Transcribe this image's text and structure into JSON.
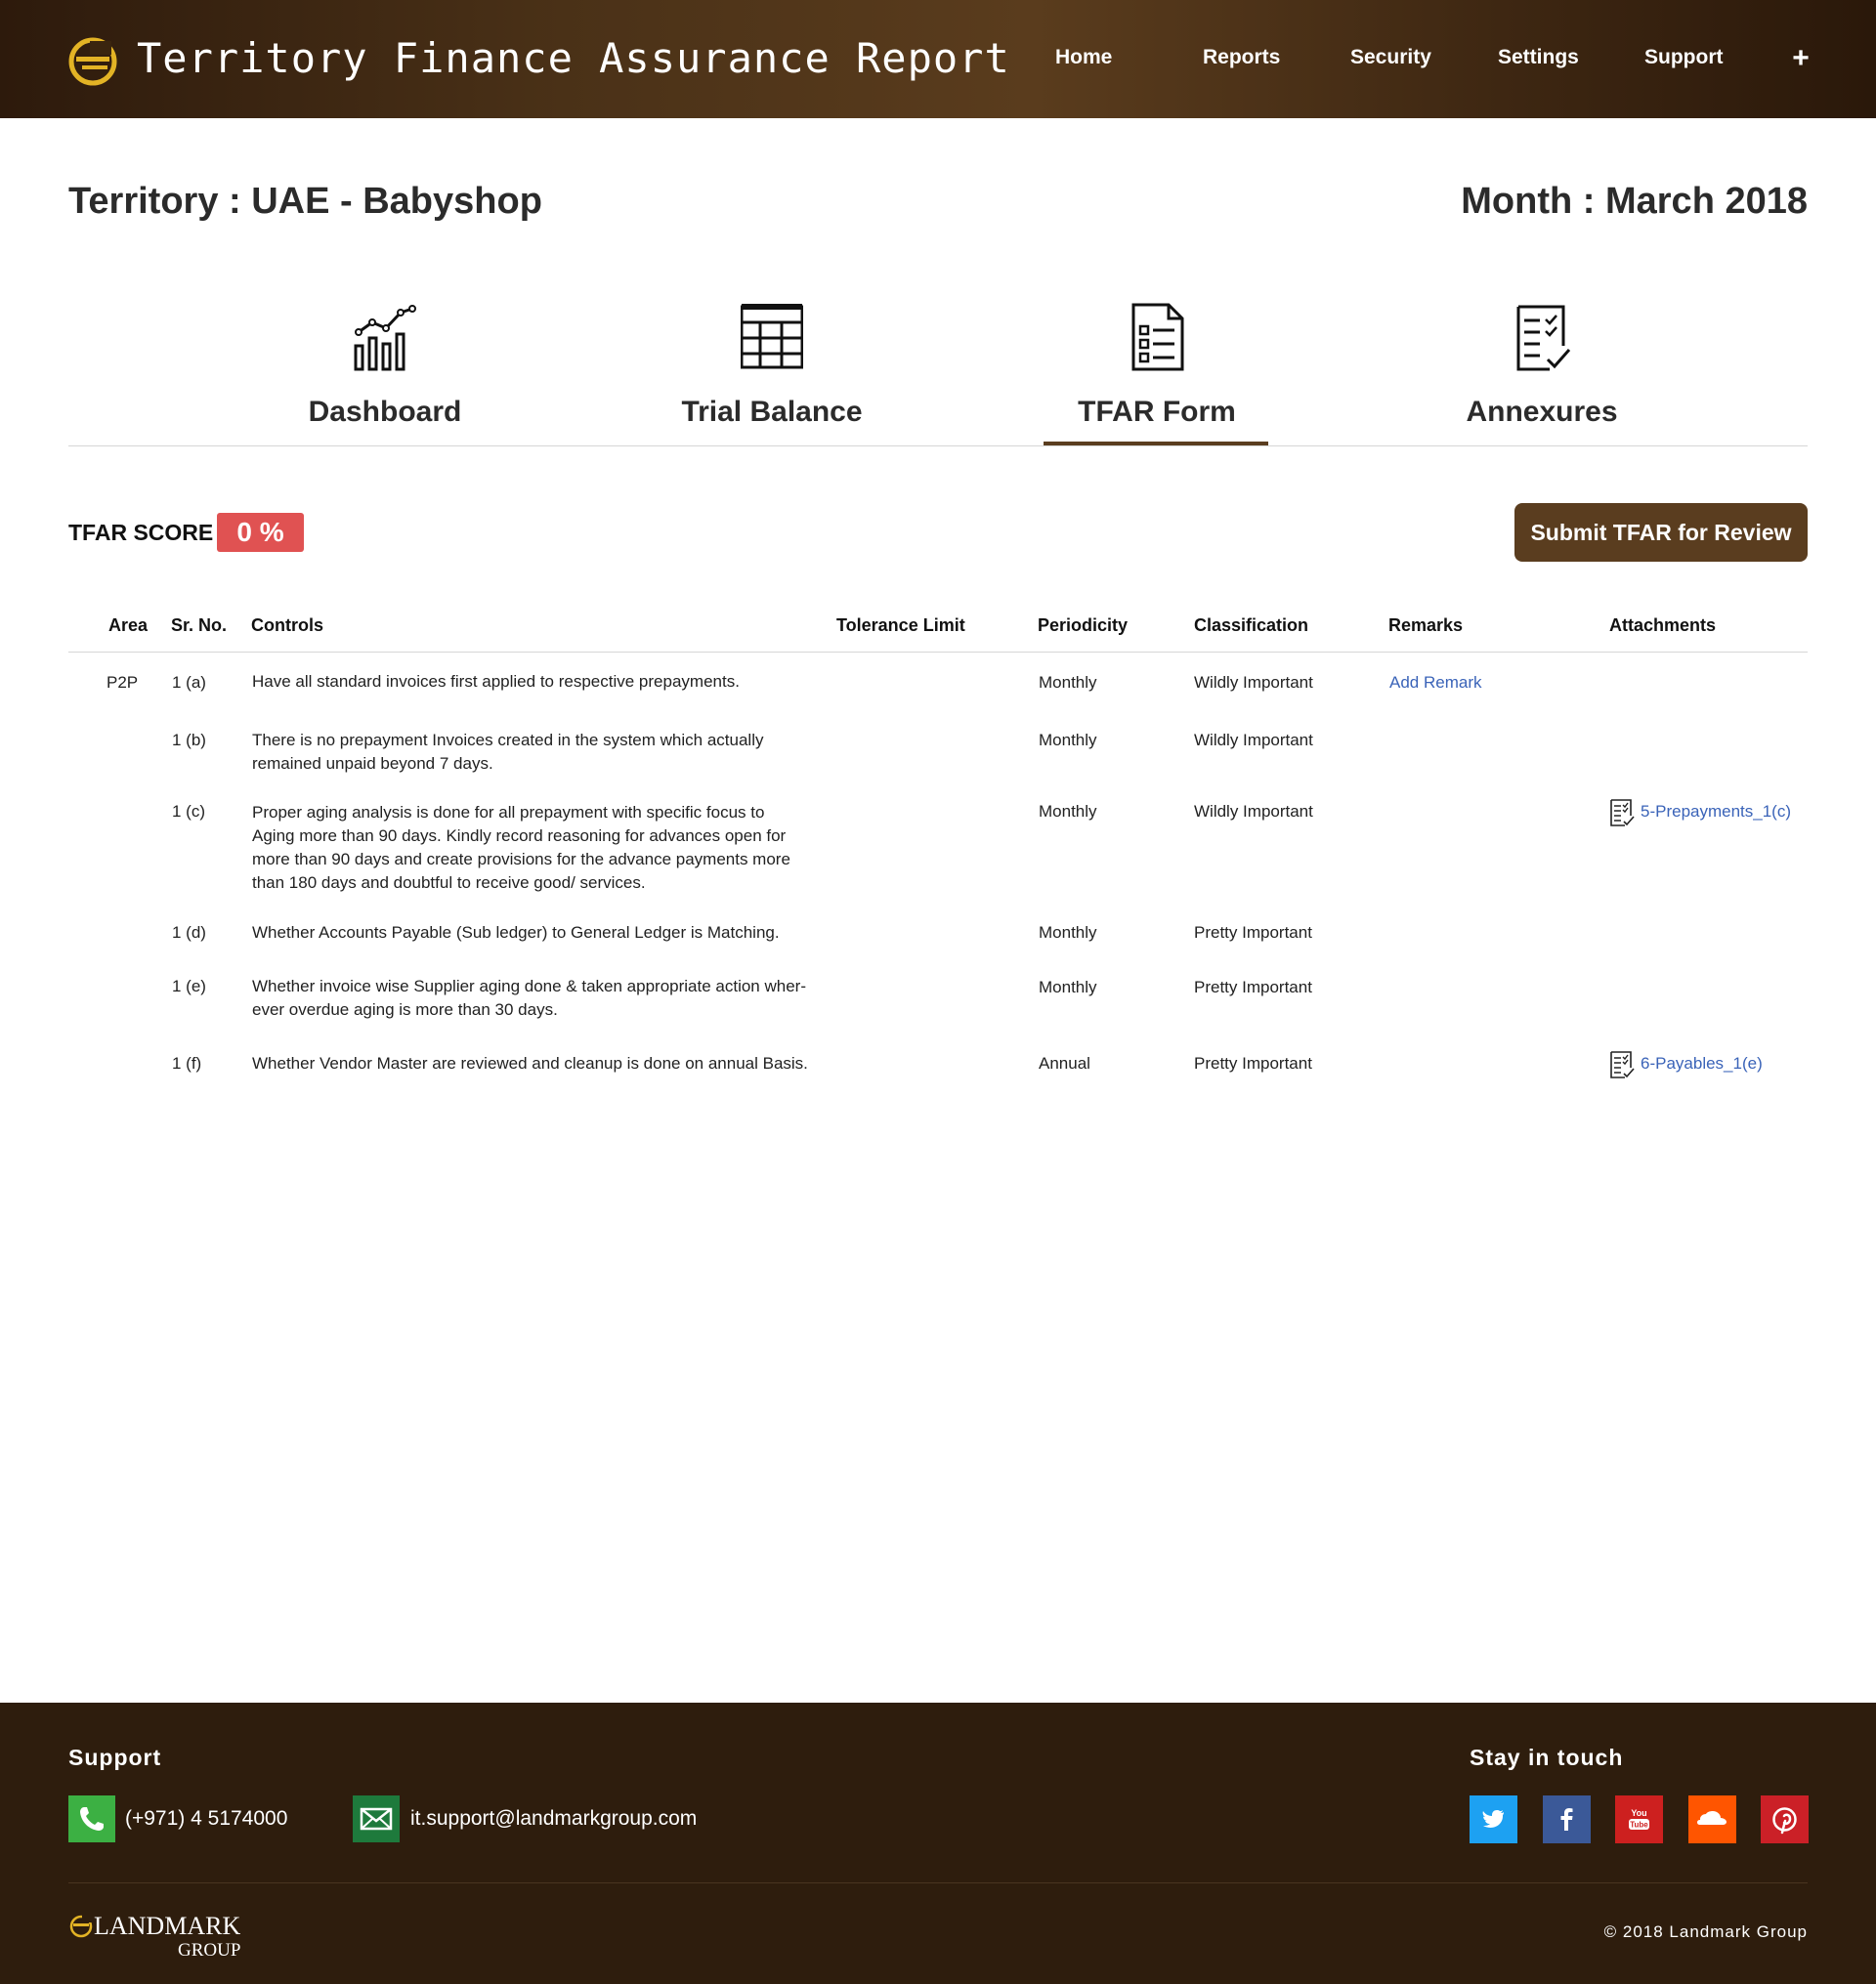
{
  "header": {
    "title": "Territory Finance Assurance Report",
    "nav": [
      "Home",
      "Reports",
      "Security",
      "Settings",
      "Support"
    ],
    "plus": "+"
  },
  "context": {
    "territory": "Territory : UAE - Babyshop",
    "month": "Month : March 2018"
  },
  "tabs": [
    {
      "label": "Dashboard",
      "icon": "chart-icon"
    },
    {
      "label": "Trial Balance",
      "icon": "table-grid-icon"
    },
    {
      "label": "TFAR Form",
      "icon": "form-list-icon",
      "active": true
    },
    {
      "label": "Annexures",
      "icon": "checklist-icon"
    }
  ],
  "score": {
    "label": "TFAR SCORE :",
    "value": "0 %",
    "badge_color": "#e05252"
  },
  "submit": {
    "label": "Submit TFAR for Review",
    "color": "#5a3d1f"
  },
  "table": {
    "headers": [
      "Area",
      "Sr. No.",
      "Controls",
      "Tolerance Limit",
      "Periodicity",
      "Classification",
      "Remarks",
      "Attachments"
    ],
    "rows": [
      {
        "area": "P2P",
        "sr": "1 (a)",
        "control_lines": [
          "Have all standard invoices first applied to respective prepayments."
        ],
        "periodicity": "Monthly",
        "classification": "Wildly Important",
        "remark": "Add Remark",
        "attachment": ""
      },
      {
        "area": "",
        "sr": "1 (b)",
        "control_lines": [
          "There is no prepayment Invoices created in the system which actually",
          "remained unpaid beyond 7 days."
        ],
        "periodicity": "Monthly",
        "classification": "Wildly Important",
        "remark": "",
        "attachment": ""
      },
      {
        "area": "",
        "sr": "1 (c)",
        "control_lines": [
          "Proper aging analysis is done for all prepayment with specific focus to",
          "Aging more than 90 days.  Kindly record reasoning for  advances open for",
          "more than 90 days and create provisions for the advance payments more",
          "than 180 days and doubtful to receive good/ services."
        ],
        "periodicity": "Monthly",
        "classification": "Wildly Important",
        "remark": "",
        "attachment": "5-Prepayments_1(c)"
      },
      {
        "area": "",
        "sr": "1 (d)",
        "control_lines": [
          "Whether Accounts Payable (Sub ledger) to General Ledger is Matching."
        ],
        "periodicity": "Monthly",
        "classification": "Pretty Important",
        "remark": "",
        "attachment": ""
      },
      {
        "area": "",
        "sr": "1 (e)",
        "control_lines": [
          "Whether invoice wise Supplier aging done & taken appropriate action wher-",
          "ever overdue aging is  more than 30 days."
        ],
        "periodicity": "Monthly",
        "classification": "Pretty Important",
        "remark": "",
        "attachment": ""
      },
      {
        "area": "",
        "sr": "1 (f)",
        "control_lines": [
          "Whether Vendor Master are reviewed and cleanup is done on annual Basis."
        ],
        "periodicity": "Annual",
        "classification": "Pretty Important",
        "remark": "",
        "attachment": "6-Payables_1(e)"
      }
    ]
  },
  "footer": {
    "support_title": "Support",
    "phone": "(+971) 4 5174000",
    "email": "it.support@landmarkgroup.com",
    "stay_title": "Stay in touch",
    "social": [
      {
        "name": "twitter",
        "color": "#1da1f2"
      },
      {
        "name": "facebook",
        "color": "#3b5998"
      },
      {
        "name": "youtube",
        "color": "#cd201f"
      },
      {
        "name": "soundcloud",
        "color": "#ff5500"
      },
      {
        "name": "pinterest",
        "color": "#cb2027"
      }
    ],
    "brand_line1": "LANDMARK",
    "brand_line2": "GROUP",
    "copyright": "© 2018 Landmark Group"
  }
}
